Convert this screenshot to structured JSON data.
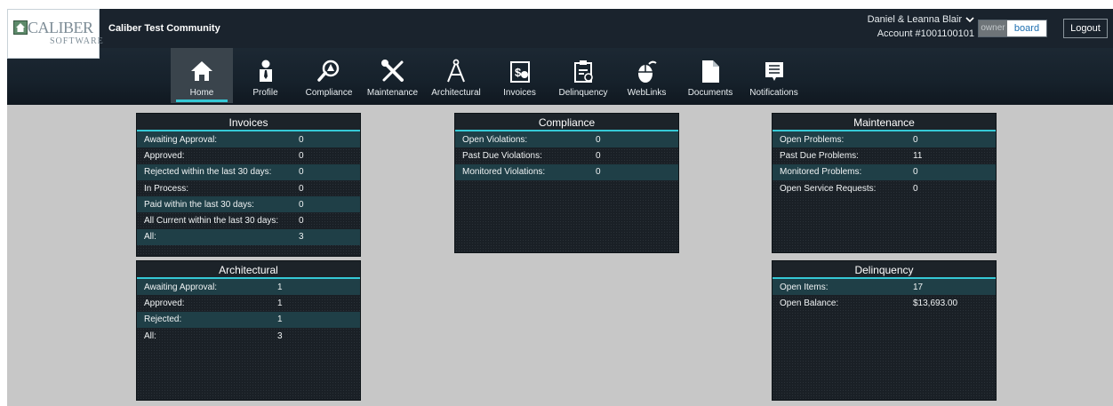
{
  "header": {
    "community": "Caliber Test Community",
    "logo": {
      "brand": "CALIBER",
      "sub": "SOFTWARE"
    },
    "user_name": "Daniel & Leanna Blair",
    "account": "Account #1001100101",
    "roles": {
      "owner": "owner",
      "board": "board"
    },
    "logout": "Logout"
  },
  "nav": [
    {
      "label": "Home",
      "icon": "home-icon"
    },
    {
      "label": "Profile",
      "icon": "profile-icon"
    },
    {
      "label": "Compliance",
      "icon": "compliance-icon"
    },
    {
      "label": "Maintenance",
      "icon": "maintenance-icon"
    },
    {
      "label": "Architectural",
      "icon": "architectural-icon"
    },
    {
      "label": "Invoices",
      "icon": "invoices-icon"
    },
    {
      "label": "Delinquency",
      "icon": "delinquency-icon"
    },
    {
      "label": "WebLinks",
      "icon": "weblinks-icon"
    },
    {
      "label": "Documents",
      "icon": "documents-icon"
    },
    {
      "label": "Notifications",
      "icon": "notifications-icon"
    }
  ],
  "colors": {
    "accent": "#35c9d6",
    "row_alt": "#1f3f47",
    "panel": "#1a2026",
    "header": "#17202a",
    "main_bg": "#c7c7c7"
  },
  "cards": {
    "invoices": {
      "title": "Invoices",
      "rows": [
        {
          "label": "Awaiting Approval:",
          "value": "0"
        },
        {
          "label": "Approved:",
          "value": "0"
        },
        {
          "label": "Rejected within the last 30 days:",
          "value": "0"
        },
        {
          "label": "In Process:",
          "value": "0"
        },
        {
          "label": "Paid within the last 30 days:",
          "value": "0"
        },
        {
          "label": "All Current within the last 30 days:",
          "value": "0"
        },
        {
          "label": "All:",
          "value": "3"
        }
      ]
    },
    "compliance": {
      "title": "Compliance",
      "rows": [
        {
          "label": "Open Violations:",
          "value": "0"
        },
        {
          "label": "Past Due Violations:",
          "value": "0"
        },
        {
          "label": "Monitored Violations:",
          "value": "0"
        }
      ]
    },
    "maintenance": {
      "title": "Maintenance",
      "rows": [
        {
          "label": "Open Problems:",
          "value": "0"
        },
        {
          "label": "Past Due Problems:",
          "value": "11"
        },
        {
          "label": "Monitored Problems:",
          "value": "0"
        },
        {
          "label": "Open Service Requests:",
          "value": "0"
        }
      ]
    },
    "architectural": {
      "title": "Architectural",
      "rows": [
        {
          "label": "Awaiting Approval:",
          "value": "1"
        },
        {
          "label": "Approved:",
          "value": "1"
        },
        {
          "label": "Rejected:",
          "value": "1"
        },
        {
          "label": "All:",
          "value": "3"
        }
      ]
    },
    "delinquency": {
      "title": "Delinquency",
      "rows": [
        {
          "label": "Open Items:",
          "value": "17"
        },
        {
          "label": "Open Balance:",
          "value": "$13,693.00"
        }
      ]
    }
  }
}
